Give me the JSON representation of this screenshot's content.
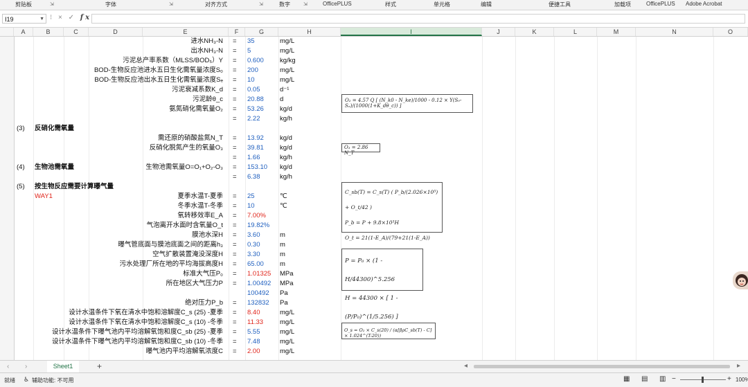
{
  "ribbon_groups": [
    "剪贴板",
    "字体",
    "对齐方式",
    "数字",
    "OfficePLUS",
    "样式",
    "单元格",
    "编辑",
    "便捷工具",
    "加载项",
    "OfficePLUS",
    "Adobe Acrobat"
  ],
  "formula_bar": {
    "name_box": "I19",
    "cancel": "×",
    "enter": "✓",
    "fx": "fx",
    "content": ""
  },
  "columns": [
    "A",
    "B",
    "C",
    "D",
    "E",
    "F",
    "G",
    "H",
    "I",
    "J",
    "K",
    "L",
    "M",
    "N",
    "O"
  ],
  "selected_column": "I",
  "rows": [
    {
      "n": "147",
      "e": "进水NH₃-N",
      "f": "=",
      "g": "35",
      "h": "mg/L"
    },
    {
      "n": "148",
      "e": "出水NH₃-N",
      "f": "=",
      "g": "5",
      "h": "mg/L"
    },
    {
      "n": "149",
      "e": "污泥总产率系数（MLSS/BOD₅）Y",
      "f": "=",
      "g": "0.600",
      "h": "kg/kg"
    },
    {
      "n": "150",
      "e": "BOD-生物反应池进水五日生化需氧量浓度S₀",
      "f": "=",
      "g": "200",
      "h": "mg/L"
    },
    {
      "n": "151",
      "e": "BOD-生物反应池出水五日生化需氧量浓度Sₑ",
      "f": "=",
      "g": "10",
      "h": "mg/L"
    },
    {
      "n": "152",
      "e": "污泥衰减系数K_d",
      "f": "=",
      "g": "0.05",
      "h": "d⁻¹"
    },
    {
      "n": "153",
      "e": "污泥龄θ_c",
      "f": "=",
      "g": "20.88",
      "h": "d"
    },
    {
      "n": "154",
      "e": "氨氮硝化需氧量O₂",
      "f": "=",
      "g": "53.26",
      "h": "kg/d"
    },
    {
      "n": "155",
      "e": "",
      "f": "=",
      "g": "2.22",
      "h": "kg/h"
    },
    {
      "n": "156",
      "a": "(3)",
      "b": "反硝化需氧量",
      "bbold": true
    },
    {
      "n": "157",
      "e": "需还原的硝酸盐氮N_T",
      "f": "=",
      "g": "13.92",
      "h": "kg/d"
    },
    {
      "n": "158",
      "e": "反硝化脱氮产生的氧量O₃",
      "f": "=",
      "g": "39.81",
      "h": "kg/d"
    },
    {
      "n": "159",
      "e": "",
      "f": "=",
      "g": "1.66",
      "h": "kg/h"
    },
    {
      "n": "160",
      "a": "(4)",
      "b": "生物池需氧量",
      "bbold": true,
      "e": "生物池需氧量O=O₁+O₂-O₃",
      "f": "=",
      "g": "153.10",
      "h": "kg/d"
    },
    {
      "n": "161",
      "e": "",
      "f": "=",
      "g": "6.38",
      "h": "kg/h"
    },
    {
      "n": "162",
      "a": "(5)",
      "b": "按生物反应需要计算曝气量",
      "bbold": true
    },
    {
      "n": "163",
      "b": "WAY1",
      "bred": true,
      "e": "夏季水温T-夏季",
      "f": "=",
      "g": "25",
      "h": "℃"
    },
    {
      "n": "164",
      "e": "冬季水温T-冬季",
      "f": "=",
      "g": "10",
      "h": "℃"
    },
    {
      "n": "165",
      "e": "氧转移效率E_A",
      "f": "=",
      "g": "7.00%",
      "gred": true,
      "h": ""
    },
    {
      "n": "166",
      "e": "气泡离开水面时含氧量O_t",
      "f": "=",
      "g": "19.82%",
      "h": ""
    },
    {
      "n": "167",
      "e": "膜池水深H",
      "f": "=",
      "g": "3.60",
      "h": "m"
    },
    {
      "n": "168",
      "e": "曝气管底面与膜池底面之间的距离h₃",
      "f": "=",
      "g": "0.30",
      "h": "m"
    },
    {
      "n": "169",
      "e": "空气扩散装置淹没深度H",
      "f": "=",
      "g": "3.30",
      "h": "m"
    },
    {
      "n": "170",
      "e": "污水处理厂所在地的平均海拔高度H",
      "f": "=",
      "g": "65.00",
      "h": "m"
    },
    {
      "n": "171",
      "e": "标准大气压P₀",
      "f": "=",
      "g": "1.01325",
      "gred": true,
      "h": "MPa"
    },
    {
      "n": "172",
      "e": "所在地区大气压力P",
      "f": "=",
      "g": "1.00492",
      "h": "MPa"
    },
    {
      "n": "173",
      "e": "",
      "f": "",
      "g": "100492",
      "h": "Pa"
    },
    {
      "n": "174",
      "e": "绝对压力P_b",
      "f": "=",
      "g": "132832",
      "h": "Pa"
    },
    {
      "n": "175",
      "e": "设计水温条件下氧在清水中饱和溶解度C_s (25) -夏季",
      "f": "=",
      "g": "8.40",
      "gred": true,
      "h": "mg/L"
    },
    {
      "n": "176",
      "e": "设计水温条件下氧在清水中饱和溶解度C_s (10) -冬季",
      "f": "=",
      "g": "11.33",
      "gred": true,
      "h": "mg/L"
    },
    {
      "n": "177",
      "e": "设计水温条件下曝气池内平均溶解氧饱和度C_sb (25) -夏季",
      "f": "=",
      "g": "5.55",
      "h": "mg/L"
    },
    {
      "n": "178",
      "e": "设计水温条件下曝气池内平均溶解氧饱和度C_sb (10) -冬季",
      "f": "=",
      "g": "7.48",
      "h": "mg/L"
    },
    {
      "n": "179",
      "e": "曝气池内平均溶解氧浓度C",
      "f": "=",
      "g": "2.00",
      "gred": true,
      "h": "mg/L"
    }
  ],
  "formulas": {
    "o2": "O₂ = 4.57 Q [ (N_k0 - N_ke)/1000 - 0.12 × Y(S₀-Sₑ)/(1000(1+K_dθ_c)) ]",
    "o3": "O₃ = 2.86 N_T",
    "csb1": "C_sb(T) = C_s(T) ( P_b/(2.026×10⁵) + O_t/42 )",
    "csb2": "P_b = P + 9.8×10³H",
    "csb3": "O_t = 21(1-E_A)/(79+21(1-E_A))",
    "p1": "P = P₀ × (1 - H/44300)^5.256",
    "p2": "H = 44300 × [ 1 - (P/P₀)^(1/5.256) ]",
    "os": "O_s = O₂ × C_s(20) / (α[βρC_sb(T) - C] × 1.024^(T-20))"
  },
  "sheet_tab": "Sheet1",
  "add_sheet": "+",
  "status": {
    "ready": "就绪",
    "accessibility": "辅助功能: 不可用",
    "zoom": "100%"
  }
}
